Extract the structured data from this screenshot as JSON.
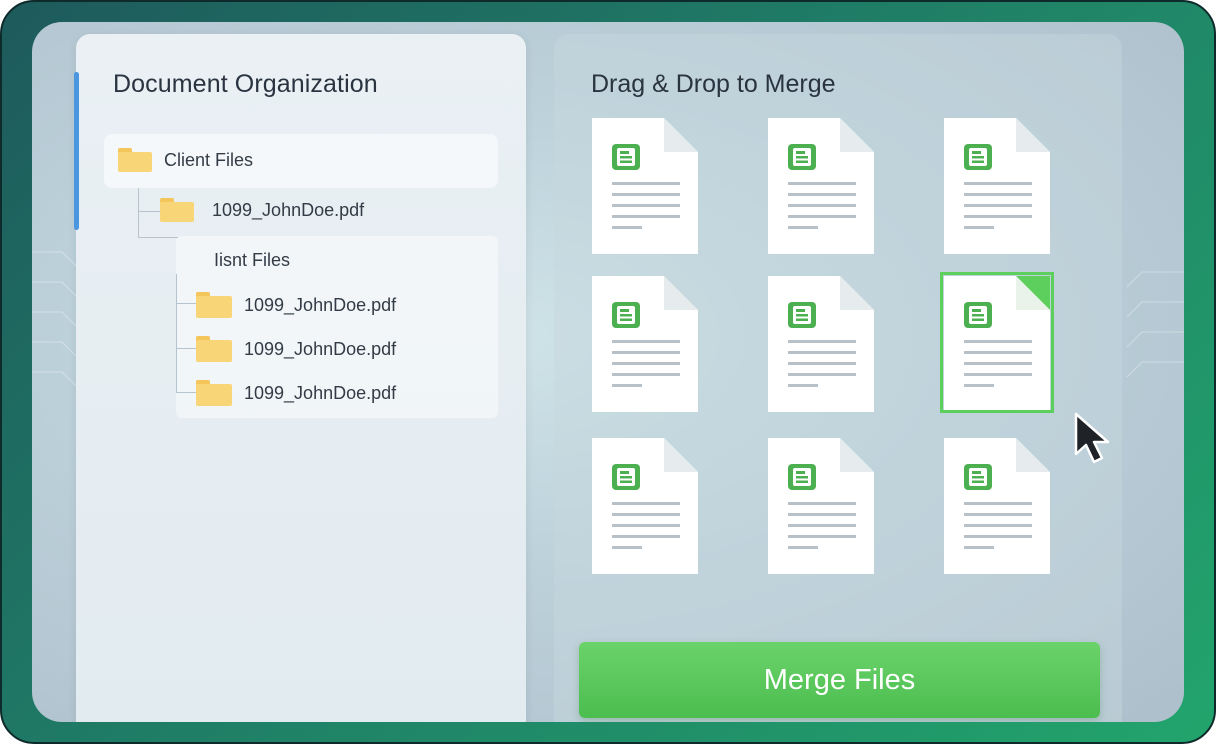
{
  "left_panel": {
    "title": "Document Organization",
    "root": {
      "label": "Client Files",
      "icon": "folder-icon"
    },
    "child": {
      "label": "1099_JohnDoe.pdf",
      "icon": "folder-icon"
    },
    "sub_group": {
      "label": "Iisnt Files",
      "items": [
        {
          "label": "1099_JohnDoe.pdf",
          "icon": "folder-icon"
        },
        {
          "label": "1099_JohnDoe.pdf",
          "icon": "folder-icon"
        },
        {
          "label": "1099_JohnDoe.pdf",
          "icon": "folder-icon"
        }
      ]
    }
  },
  "right_panel": {
    "title": "Drag & Drop to Merge",
    "documents": [
      {
        "icon": "document-icon",
        "selected": false
      },
      {
        "icon": "document-icon",
        "selected": false
      },
      {
        "icon": "document-icon",
        "selected": false
      },
      {
        "icon": "document-icon",
        "selected": false
      },
      {
        "icon": "document-icon",
        "selected": false
      },
      {
        "icon": "document-icon",
        "selected": true
      },
      {
        "icon": "document-icon",
        "selected": false
      },
      {
        "icon": "document-icon",
        "selected": false
      },
      {
        "icon": "document-icon",
        "selected": false
      }
    ],
    "merge_button_label": "Merge Files"
  },
  "colors": {
    "accent_green": "#4cbd4f",
    "doc_icon_green": "#4caf50",
    "folder_yellow": "#f8d577",
    "accent_blue": "#4a97e0",
    "frame_green": "#1f7d66"
  },
  "cursor": {
    "icon": "mouse-pointer-icon"
  }
}
